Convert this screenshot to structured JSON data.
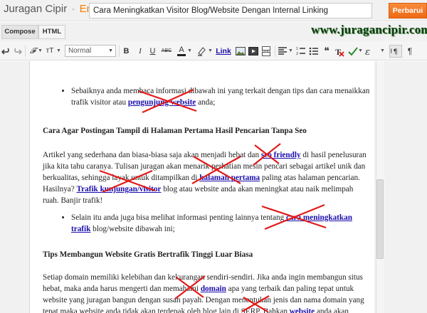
{
  "header": {
    "blog_name": "Juragan Cipir",
    "separator": "·",
    "section": "Entri",
    "post_title": "Cara Meningkatkan Visitor Blog/Website Dengan Internal Linking",
    "publish_label": "Perbarui"
  },
  "mode_tabs": [
    "Compose",
    "HTML"
  ],
  "watermark": "www.juragancipir.com",
  "toolbar": {
    "font_glyph": "𝓕",
    "size_glyph": "ᴛT",
    "style_value": "Normal",
    "bold": "B",
    "italic": "I",
    "underline": "U",
    "strike": "ABC",
    "text_color": "A",
    "link": "Link",
    "quote": "❝",
    "rtl": "¶",
    "icons": [
      "undo-icon",
      "redo-icon",
      "font-icon",
      "font-size-icon",
      "bold-icon",
      "italic-icon",
      "underline-icon",
      "strikethrough-icon",
      "text-color-icon",
      "highlight-icon",
      "link-icon",
      "image-icon",
      "video-icon",
      "jump-break-icon",
      "align-icon",
      "numbered-list-icon",
      "bullet-list-icon",
      "quote-icon",
      "remove-formatting-icon",
      "spellcheck-icon",
      "language-icon",
      "ltr-icon",
      "rtl-icon"
    ]
  },
  "content": {
    "item1_text": "Sebaiknya anda membaca informasi dibawah ini yang terkait dengan tips dan cara menaikkan trafik visitor atau ",
    "item1_link": "pengunjung website",
    "item1_end": " anda;",
    "heading1": "Cara Agar Postingan Tampil di Halaman Pertama Hasil Pencarian Tanpa Seo",
    "para1_a": "Artikel yang sederhana dan biasa-biasa saja akan menjadi hebat dan ",
    "para1_link1": "seo friendly",
    "para1_b": " di hasil penelusuran jika kita tahu caranya. Tulisan juragan akan menarik perhatian mesin pencari sebagai artikel unik dan berkualitas, sehingga layak untuk ditampilkan di ",
    "para1_link2": "halaman pertama",
    "para1_c": " paling atas halaman pencarian. Hasilnya? ",
    "para1_link3": "Trafik kunjungan/visitor",
    "para1_d": " blog atau website anda akan meningkat atau naik melimpah ruah. Banjir trafik!",
    "item2_text": "Selain itu anda juga bisa melihat informasi penting lainnya tentang ",
    "item2_link": "cara meningkatkan trafik",
    "item2_end": " blog/website dibawah ini;",
    "heading2": "Tips Membangun Website Gratis Bertrafik Tinggi Luar Biasa",
    "para2_a": "Setiap domain memiliki kelebihan dan kekurangan sendiri-sendiri. Jika anda ingin membangun situs hebat, maka anda harus mengerti dan memahami ",
    "para2_link1": "domain",
    "para2_b": " apa yang terbaik dan paling tepat untuk website yang juragan bangun dengan susah payah. Dengan menentukan jenis dan nama domain yang tepat maka website anda tidak akan terdepak oleh blog lain di SERP. Bahkan ",
    "para2_link2": "website",
    "para2_c": " anda akan mengusir semua"
  }
}
